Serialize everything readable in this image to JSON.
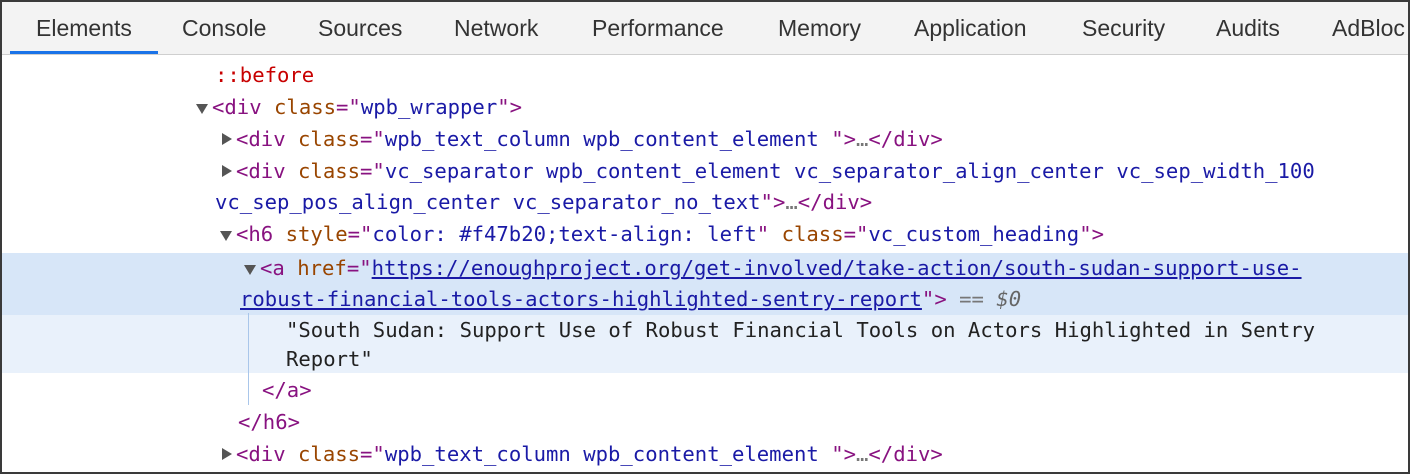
{
  "tabs": [
    {
      "label": "Elements",
      "active": true
    },
    {
      "label": "Console"
    },
    {
      "label": "Sources"
    },
    {
      "label": "Network"
    },
    {
      "label": "Performance"
    },
    {
      "label": "Memory"
    },
    {
      "label": "Application"
    },
    {
      "label": "Security"
    },
    {
      "label": "Audits"
    },
    {
      "label": "AdBloc"
    }
  ],
  "colors": {
    "tag": "#881280",
    "attr_name": "#994500",
    "attr_value": "#1a1aa6",
    "pseudo": "#c80000",
    "selected_bg": "#d7e6f8",
    "active_tab_underline": "#1a73e8"
  },
  "dom": {
    "before": "::before",
    "wrapper": {
      "open": "<div",
      "attr": "class",
      "eq": "=\"",
      "value": "wpb_wrapper",
      "close": "\">"
    },
    "row1": {
      "open": "<div",
      "attr": "class",
      "value": "wpb_text_column wpb_content_element ",
      "ellipsis": "…",
      "end": "</div>"
    },
    "row2": {
      "open": "<div",
      "attr": "class",
      "value_part1": "vc_separator wpb_content_element vc_separator_align_center vc_sep_width_100",
      "value_part2": "vc_sep_pos_align_center vc_separator_no_text",
      "ellipsis": "…",
      "end": "</div>"
    },
    "h6": {
      "open": "<h6",
      "attr1": "style",
      "value1": "color: #f47b20;text-align: left",
      "attr2": "class",
      "value2": "vc_custom_heading"
    },
    "anchor": {
      "open": "<a",
      "attr": "href",
      "href_part1": "https://enoughproject.org/get-involved/take-action/south-sudan-support-use-",
      "href_part2": "robust-financial-tools-actors-highlighted-sentry-report",
      "eq_marker": "==",
      "dollar": "$0"
    },
    "text_node_part1": "\"South Sudan: Support Use of Robust Financial Tools on Actors Highlighted in Sentry",
    "text_node_part2": "Report\"",
    "close_a": "</a>",
    "close_h6": "</h6>",
    "row_last": {
      "open": "<div",
      "attr": "class",
      "value": "wpb_text_column wpb_content_element ",
      "ellipsis": "…",
      "end": "</div>"
    }
  }
}
